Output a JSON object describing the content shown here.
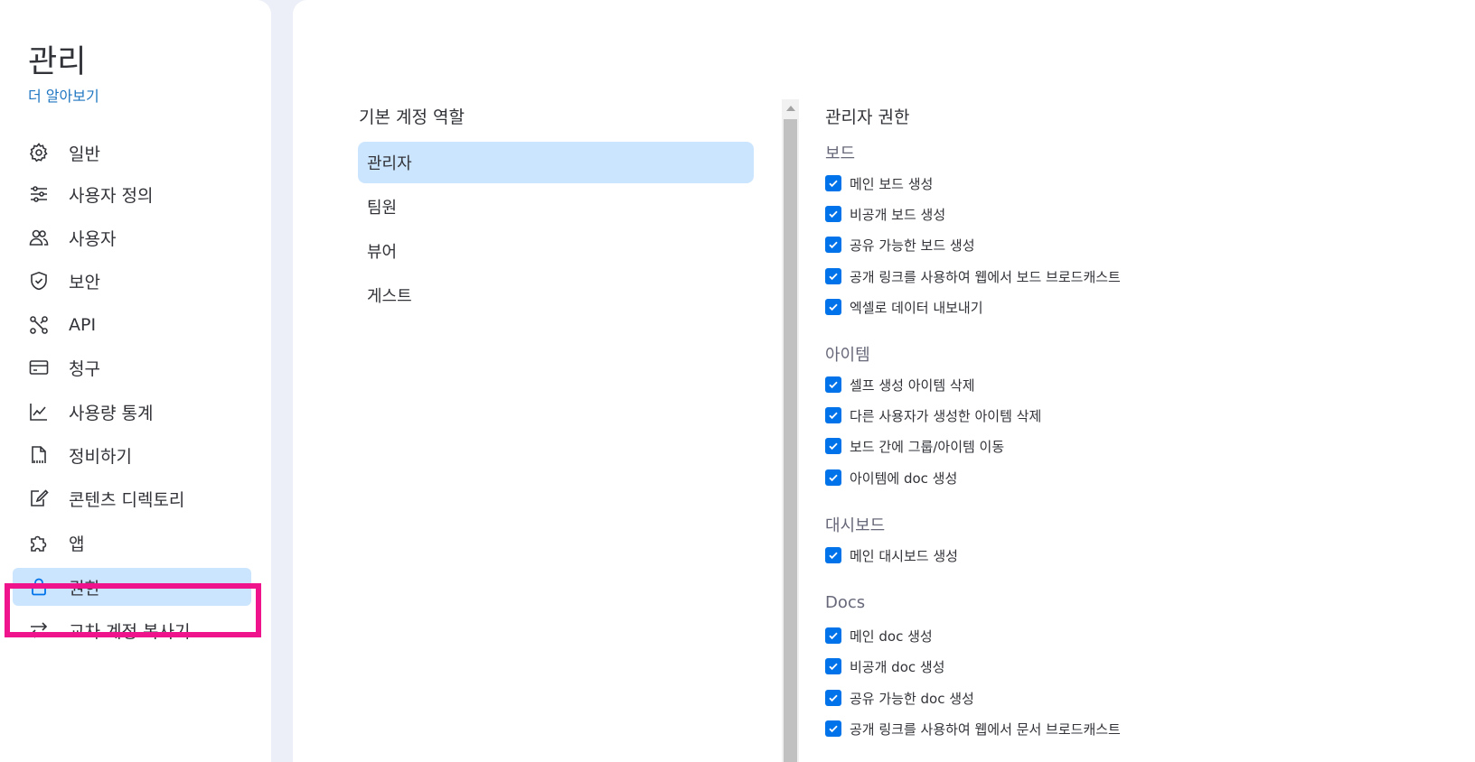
{
  "sidebar": {
    "title": "관리",
    "learn_more": "더 알아보기",
    "items": [
      {
        "label": "일반",
        "icon": "gear-icon"
      },
      {
        "label": "사용자 정의",
        "icon": "sliders-icon"
      },
      {
        "label": "사용자",
        "icon": "users-icon"
      },
      {
        "label": "보안",
        "icon": "shield-icon"
      },
      {
        "label": "API",
        "icon": "api-icon"
      },
      {
        "label": "청구",
        "icon": "credit-card-icon"
      },
      {
        "label": "사용량 통계",
        "icon": "chart-icon"
      },
      {
        "label": "정비하기",
        "icon": "document-icon"
      },
      {
        "label": "콘텐츠 디렉토리",
        "icon": "edit-document-icon"
      },
      {
        "label": "앱",
        "icon": "puzzle-icon"
      },
      {
        "label": "권한",
        "icon": "lock-icon",
        "active": true
      },
      {
        "label": "교차 계정 복사기",
        "icon": "transfer-arrows-icon"
      }
    ]
  },
  "roles": {
    "title": "기본 계정 역할",
    "items": [
      {
        "label": "관리자",
        "selected": true
      },
      {
        "label": "팀원"
      },
      {
        "label": "뷰어"
      },
      {
        "label": "게스트"
      }
    ]
  },
  "permissions": {
    "title": "관리자 권한",
    "groups": [
      {
        "title": "보드",
        "items": [
          {
            "label": "메인 보드 생성",
            "checked": true
          },
          {
            "label": "비공개 보드 생성",
            "checked": true
          },
          {
            "label": "공유 가능한 보드 생성",
            "checked": true
          },
          {
            "label": "공개 링크를 사용하여 웹에서 보드 브로드캐스트",
            "checked": true
          },
          {
            "label": "엑셀로 데이터 내보내기",
            "checked": true
          }
        ]
      },
      {
        "title": "아이템",
        "items": [
          {
            "label": "셀프 생성 아이템 삭제",
            "checked": true
          },
          {
            "label": "다른 사용자가 생성한 아이템 삭제",
            "checked": true
          },
          {
            "label": "보드 간에 그룹/아이템 이동",
            "checked": true
          },
          {
            "label": "아이템에 doc 생성",
            "checked": true
          }
        ]
      },
      {
        "title": "대시보드",
        "items": [
          {
            "label": "메인 대시보드 생성",
            "checked": true
          }
        ]
      },
      {
        "title": "Docs",
        "items": [
          {
            "label": "메인 doc 생성",
            "checked": true
          },
          {
            "label": "비공개 doc 생성",
            "checked": true
          },
          {
            "label": "공유 가능한 doc 생성",
            "checked": true
          },
          {
            "label": "공개 링크를 사용하여 웹에서 문서 브로드캐스트",
            "checked": true
          }
        ]
      }
    ]
  },
  "colors": {
    "accent": "#0073ea",
    "active_bg": "#cce5ff",
    "highlight": "#f0148c",
    "link": "#1f76c2"
  }
}
